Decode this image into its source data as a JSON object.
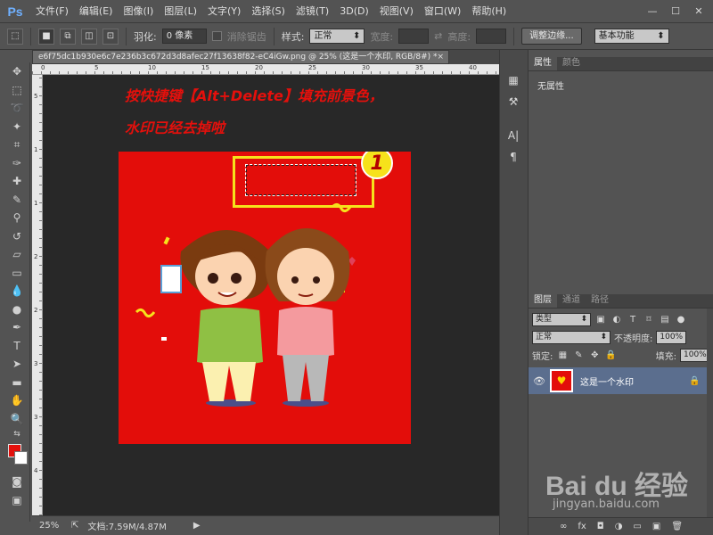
{
  "app": {
    "logo": "Ps",
    "menus": [
      "文件(F)",
      "编辑(E)",
      "图像(I)",
      "图层(L)",
      "文字(Y)",
      "选择(S)",
      "滤镜(T)",
      "3D(D)",
      "视图(V)",
      "窗口(W)",
      "帮助(H)"
    ],
    "window_controls": [
      "—",
      "☐",
      "✕"
    ]
  },
  "options_bar": {
    "feather_label": "羽化:",
    "feather_value": "0 像素",
    "antialias_label": "消除锯齿",
    "style_label": "样式:",
    "style_value": "正常",
    "width_label": "宽度:",
    "height_label": "高度:",
    "refine_button": "调整边缘...",
    "workspace": "基本功能"
  },
  "document": {
    "tab_title": "e6f75dc1b930e6c7e236b3c672d3d8afec27f13638f82-eC4iGw.png @ 25% (这是一个水印, RGB/8#) *",
    "tab_close": "×",
    "annotation_line1": "按快捷键【Alt+Delete】填充前景色，",
    "annotation_line2": "水印已经去掉啦",
    "step_number": "1",
    "ruler_h_labels": [
      "0",
      "5",
      "10",
      "15",
      "20",
      "25",
      "30",
      "35",
      "40"
    ],
    "ruler_v_labels": [
      "5",
      "1",
      "1",
      "2",
      "2",
      "3",
      "3",
      "4"
    ]
  },
  "status": {
    "zoom": "25%",
    "doc_info": "文档:7.59M/4.87M"
  },
  "properties_panel": {
    "tabs": [
      "属性",
      "颜色"
    ],
    "content": "无属性"
  },
  "layers_panel": {
    "tabs": [
      "图层",
      "通道",
      "路径"
    ],
    "filter_kind": "类型",
    "blend_mode": "正常",
    "opacity_label": "不透明度:",
    "opacity_value": "100%",
    "lock_label": "锁定:",
    "fill_label": "填充:",
    "fill_value": "100%",
    "layer_name": "这是一个水印",
    "footer_icons": [
      "∞",
      "fx",
      "◘",
      "◑",
      "▭",
      "▣",
      "🗑"
    ]
  },
  "watermark": {
    "logo": "Bai du 经验",
    "url": "jingyan.baidu.com"
  },
  "colors": {
    "foreground": "#e3100c",
    "background": "#ffffff",
    "image_bg": "#e30d0a",
    "highlight": "#f6e21b",
    "annotation": "#e4100c"
  }
}
